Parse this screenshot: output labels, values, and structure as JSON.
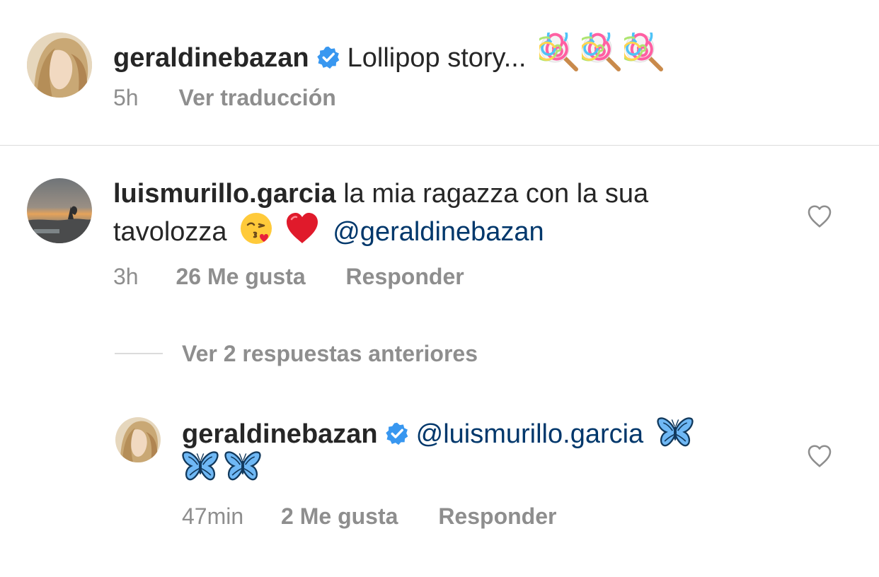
{
  "caption": {
    "username": "geraldinebazan",
    "text": "Lollipop story...",
    "time": "5h",
    "translate_label": "Ver traducción",
    "emoji": [
      "lollipop-icon",
      "lollipop-icon",
      "lollipop-icon"
    ]
  },
  "comment": {
    "username": "luismurillo.garcia",
    "text_line1": "la mia ragazza con la sua",
    "text_line2": "tavolozza",
    "mention": "@geraldinebazan",
    "emoji": [
      "kiss-face-icon",
      "red-heart-icon"
    ],
    "time": "3h",
    "likes": "26 Me gusta",
    "reply_label": "Responder"
  },
  "view_replies_label": "Ver 2 respuestas anteriores",
  "reply": {
    "username": "geraldinebazan",
    "mention": "@luismurillo.garcia",
    "emoji": [
      "butterfly-icon",
      "butterfly-icon",
      "butterfly-icon"
    ],
    "time": "47min",
    "likes": "2 Me gusta",
    "reply_label": "Responder"
  },
  "colors": {
    "text": "#262626",
    "secondary": "#8e8e8e",
    "mention": "#00376b",
    "verified": "#3897f0",
    "divider": "#dbdbdb"
  }
}
